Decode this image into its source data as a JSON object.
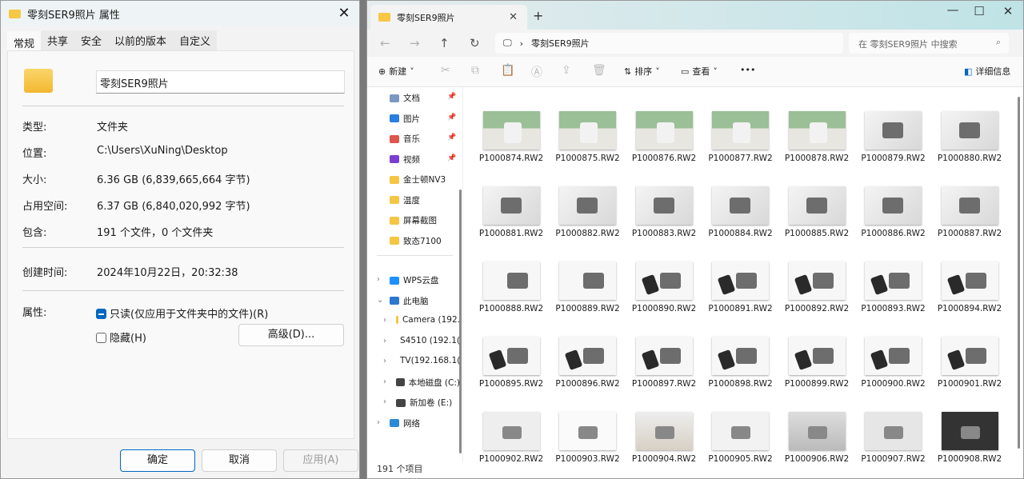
{
  "dialog": {
    "title": "零刻SER9照片 属性",
    "close": "✕",
    "tabs": [
      "常规",
      "共享",
      "安全",
      "以前的版本",
      "自定义"
    ],
    "name": "零刻SER9照片",
    "fields": [
      {
        "label": "类型:",
        "value": "文件夹"
      },
      {
        "label": "位置:",
        "value": "C:\\Users\\XuNing\\Desktop"
      },
      {
        "label": "大小:",
        "value": "6.36 GB (6,839,665,664 字节)"
      },
      {
        "label": "占用空间:",
        "value": "6.37 GB (6,840,020,992 字节)"
      },
      {
        "label": "包含:",
        "value": "191 个文件，0 个文件夹"
      }
    ],
    "created_label": "创建时间:",
    "created": "2024年10月22日，20:32:38",
    "attr_label": "属性:",
    "readonly": "只读(仅应用于文件夹中的文件)(R)",
    "readonly_checked": true,
    "hidden": "隐藏(H)",
    "hidden_checked": false,
    "advanced": "高级(D)...",
    "ok": "确定",
    "cancel": "取消",
    "apply": "应用(A)"
  },
  "explorer": {
    "tab": "零刻SER9照片",
    "tab_close": "✕",
    "new_tab": "+",
    "minimize": "—",
    "maximize": "☐",
    "close": "✕",
    "path": "零刻SER9照片",
    "search_placeholder": "在 零刻SER9照片 中搜索",
    "toolbar": {
      "new": "新建",
      "sort": "排序",
      "view": "查看",
      "more": "•••",
      "details": "详细信息"
    },
    "sidebar": [
      {
        "label": "文档",
        "icon": "document-icon",
        "pinned": true
      },
      {
        "label": "图片",
        "icon": "pictures-icon",
        "pinned": true
      },
      {
        "label": "音乐",
        "icon": "music-icon",
        "pinned": true
      },
      {
        "label": "视频",
        "icon": "video-icon",
        "pinned": true
      },
      {
        "label": "金士顿NV3",
        "icon": "folder-icon"
      },
      {
        "label": "温度",
        "icon": "folder-icon"
      },
      {
        "label": "屏幕截图",
        "icon": "folder-icon"
      },
      {
        "label": "致态7100",
        "icon": "folder-icon"
      }
    ],
    "tree": [
      {
        "label": "WPS云盘",
        "icon": "cloud-icon",
        "level": 0,
        "expanded": false
      },
      {
        "label": "此电脑",
        "icon": "pc-icon",
        "level": 0,
        "expanded": true
      },
      {
        "label": "Camera (192.",
        "icon": "network-folder-icon",
        "level": 1
      },
      {
        "label": "S4510 (192.1(",
        "icon": "network-folder-icon",
        "level": 1
      },
      {
        "label": "TV(192.168.1(",
        "icon": "network-folder-icon",
        "level": 1
      },
      {
        "label": "本地磁盘 (C:)",
        "icon": "drive-icon",
        "level": 1
      },
      {
        "label": "新加卷 (E:)",
        "icon": "drive-icon",
        "level": 1
      },
      {
        "label": "网络",
        "icon": "network-icon",
        "level": 0,
        "expanded": false
      }
    ],
    "files": [
      "P1000874.RW2",
      "P1000875.RW2",
      "P1000876.RW2",
      "P1000877.RW2",
      "P1000878.RW2",
      "P1000879.RW2",
      "P1000880.RW2",
      "P1000881.RW2",
      "P1000882.RW2",
      "P1000883.RW2",
      "P1000884.RW2",
      "P1000885.RW2",
      "P1000886.RW2",
      "P1000887.RW2",
      "P1000888.RW2",
      "P1000889.RW2",
      "P1000890.RW2",
      "P1000891.RW2",
      "P1000892.RW2",
      "P1000893.RW2",
      "P1000894.RW2",
      "P1000895.RW2",
      "P1000896.RW2",
      "P1000897.RW2",
      "P1000898.RW2",
      "P1000899.RW2",
      "P1000900.RW2",
      "P1000901.RW2",
      "P1000902.RW2",
      "P1000903.RW2",
      "P1000904.RW2",
      "P1000905.RW2",
      "P1000906.RW2",
      "P1000907.RW2",
      "P1000908.RW2"
    ],
    "status": "191 个项目"
  }
}
